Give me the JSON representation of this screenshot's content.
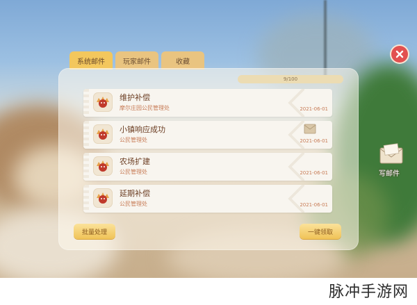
{
  "tabs": [
    {
      "label": "系统邮件",
      "active": true
    },
    {
      "label": "玩家邮件",
      "active": false
    },
    {
      "label": "收藏",
      "active": false
    }
  ],
  "capacity": "9/100",
  "mails": [
    {
      "title": "维护补偿",
      "sender": "摩尔庄园公民管理处",
      "date": "2021-06-01",
      "has_attachment": false
    },
    {
      "title": "小镇响应成功",
      "sender": "公民管理处",
      "date": "2021-06-01",
      "has_attachment": true
    },
    {
      "title": "农场扩建",
      "sender": "公民管理处",
      "date": "2021-06-01",
      "has_attachment": false
    },
    {
      "title": "延期补偿",
      "sender": "公民管理处",
      "date": "2021-06-01",
      "has_attachment": false
    }
  ],
  "buttons": {
    "batch": "批量处理",
    "claim_all": "一键领取"
  },
  "write_mail": "写邮件",
  "watermark": "脉冲手游网",
  "colors": {
    "tab_active": "#f3c75d",
    "close_button": "#e25050",
    "date_text": "#c77b55"
  },
  "icons": {
    "close": "close-icon",
    "avatar": "mole-avatar-icon",
    "attachment": "envelope-attachment-icon",
    "write": "write-letter-icon"
  }
}
